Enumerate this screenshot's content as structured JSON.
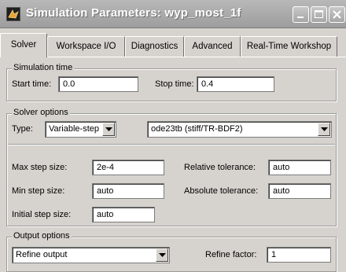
{
  "window": {
    "title": "Simulation Parameters: wyp_most_1f"
  },
  "tabs": [
    {
      "label": "Solver",
      "active": true
    },
    {
      "label": "Workspace I/O",
      "active": false
    },
    {
      "label": "Diagnostics",
      "active": false
    },
    {
      "label": "Advanced",
      "active": false
    },
    {
      "label": "Real-Time Workshop",
      "active": false
    }
  ],
  "simulation_time": {
    "title": "Simulation time",
    "start_label": "Start time:",
    "start_value": "0.0",
    "stop_label": "Stop time:",
    "stop_value": "0.4"
  },
  "solver_options": {
    "title": "Solver options",
    "type_label": "Type:",
    "type_value": "Variable-step",
    "solver_value": "ode23tb (stiff/TR-BDF2)",
    "max_step_label": "Max step size:",
    "max_step_value": "2e-4",
    "min_step_label": "Min step size:",
    "min_step_value": "auto",
    "initial_step_label": "Initial step size:",
    "initial_step_value": "auto",
    "rel_tol_label": "Relative tolerance:",
    "rel_tol_value": "auto",
    "abs_tol_label": "Absolute tolerance:",
    "abs_tol_value": "auto"
  },
  "output_options": {
    "title": "Output options",
    "mode_value": "Refine output",
    "refine_label": "Refine factor:",
    "refine_value": "1"
  },
  "icons": {
    "app": "matlab-simulink-icon",
    "minimize": "minimize-icon",
    "maximize": "maximize-icon",
    "close": "close-icon",
    "dropdown": "chevron-down-icon"
  }
}
